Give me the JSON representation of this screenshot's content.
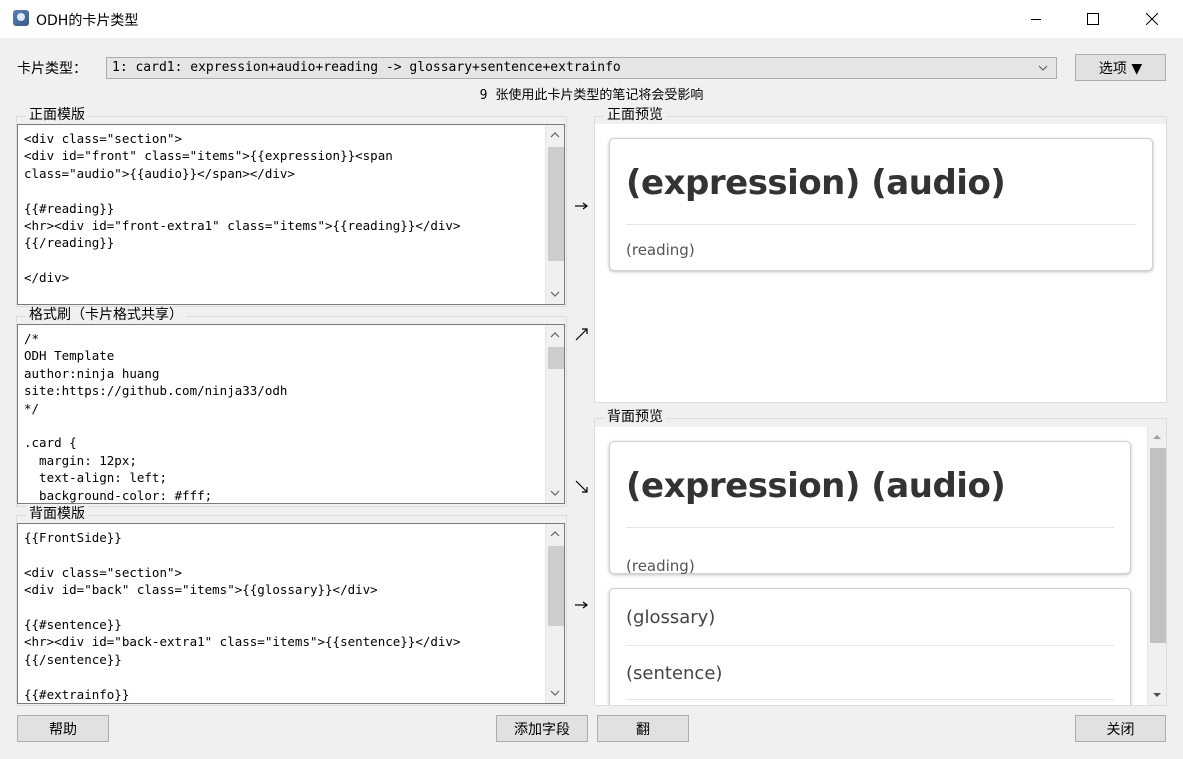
{
  "window": {
    "title": "ODH的卡片类型"
  },
  "header": {
    "card_type_label": "卡片类型：",
    "card_type_value": "1: card1: expression+audio+reading -> glossary+sentence+extrainfo",
    "options_label": "选项 ▼",
    "notice": "9 张使用此卡片类型的笔记将会受影响"
  },
  "front_template": {
    "title": "正面模版",
    "code": "<div class=\"section\">\n<div id=\"front\" class=\"items\">{{expression}}<span\nclass=\"audio\">{{audio}}</span></div>\n\n{{#reading}}\n<hr><div id=\"front-extra1\" class=\"items\">{{reading}}</div>\n{{/reading}}\n\n</div>"
  },
  "styling": {
    "title": "格式刷（卡片格式共享）",
    "code": "/*\nODH Template\nauthor:ninja huang\nsite:https://github.com/ninja33/odh\n*/\n\n.card {\n  margin: 12px;\n  text-align: left;\n  background-color: #fff;"
  },
  "back_template": {
    "title": "背面模版",
    "code": "{{FrontSide}}\n\n<div class=\"section\">\n<div id=\"back\" class=\"items\">{{glossary}}</div>\n\n{{#sentence}}\n<hr><div id=\"back-extra1\" class=\"items\">{{sentence}}</div>\n{{/sentence}}\n\n{{#extrainfo}}"
  },
  "front_preview": {
    "title": "正面预览",
    "heading": "(expression) (audio)",
    "reading": "(reading)"
  },
  "back_preview": {
    "title": "背面预览",
    "heading": "(expression) (audio)",
    "reading": "(reading)",
    "glossary": "(glossary)",
    "sentence": "(sentence)"
  },
  "footer": {
    "help_label": "帮助",
    "add_field_label": "添加字段",
    "flip_label": "翻",
    "close_label": "关闭"
  },
  "icons": {
    "app": "odh-app-icon",
    "minimize": "minimize-icon",
    "maximize": "maximize-icon",
    "close": "close-icon"
  },
  "colors": {
    "window_bg": "#f0f0f0",
    "titlebar_bg": "#ffffff",
    "button_bg": "#e1e1e1",
    "card_text": "#333333"
  }
}
